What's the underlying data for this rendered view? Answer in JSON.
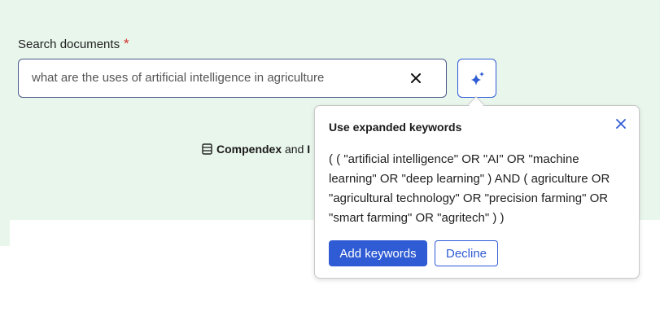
{
  "search": {
    "label": "Search documents",
    "required_marker": "*",
    "value": "what are the uses of artificial intelligence in agriculture"
  },
  "icons": {
    "clear": "close-icon",
    "ai_expand": "sparkle-icon",
    "database": "database-icon",
    "popover_close": "close-icon"
  },
  "databases": {
    "first": "Compendex",
    "joiner": " and ",
    "second_partial": "I"
  },
  "popover": {
    "title": "Use expanded keywords",
    "query": "( ( \"artificial intelligence\" OR \"AI\" OR \"machine learning\" OR \"deep learning\" ) AND ( agriculture OR \"agricultural technology\" OR \"precision farming\" OR \"smart farming\" OR \"agritech\" ) )",
    "add_label": "Add keywords",
    "decline_label": "Decline"
  },
  "colors": {
    "accent": "#2f5bd4",
    "page_bg": "#e9f6ec",
    "required": "#d0342c"
  }
}
